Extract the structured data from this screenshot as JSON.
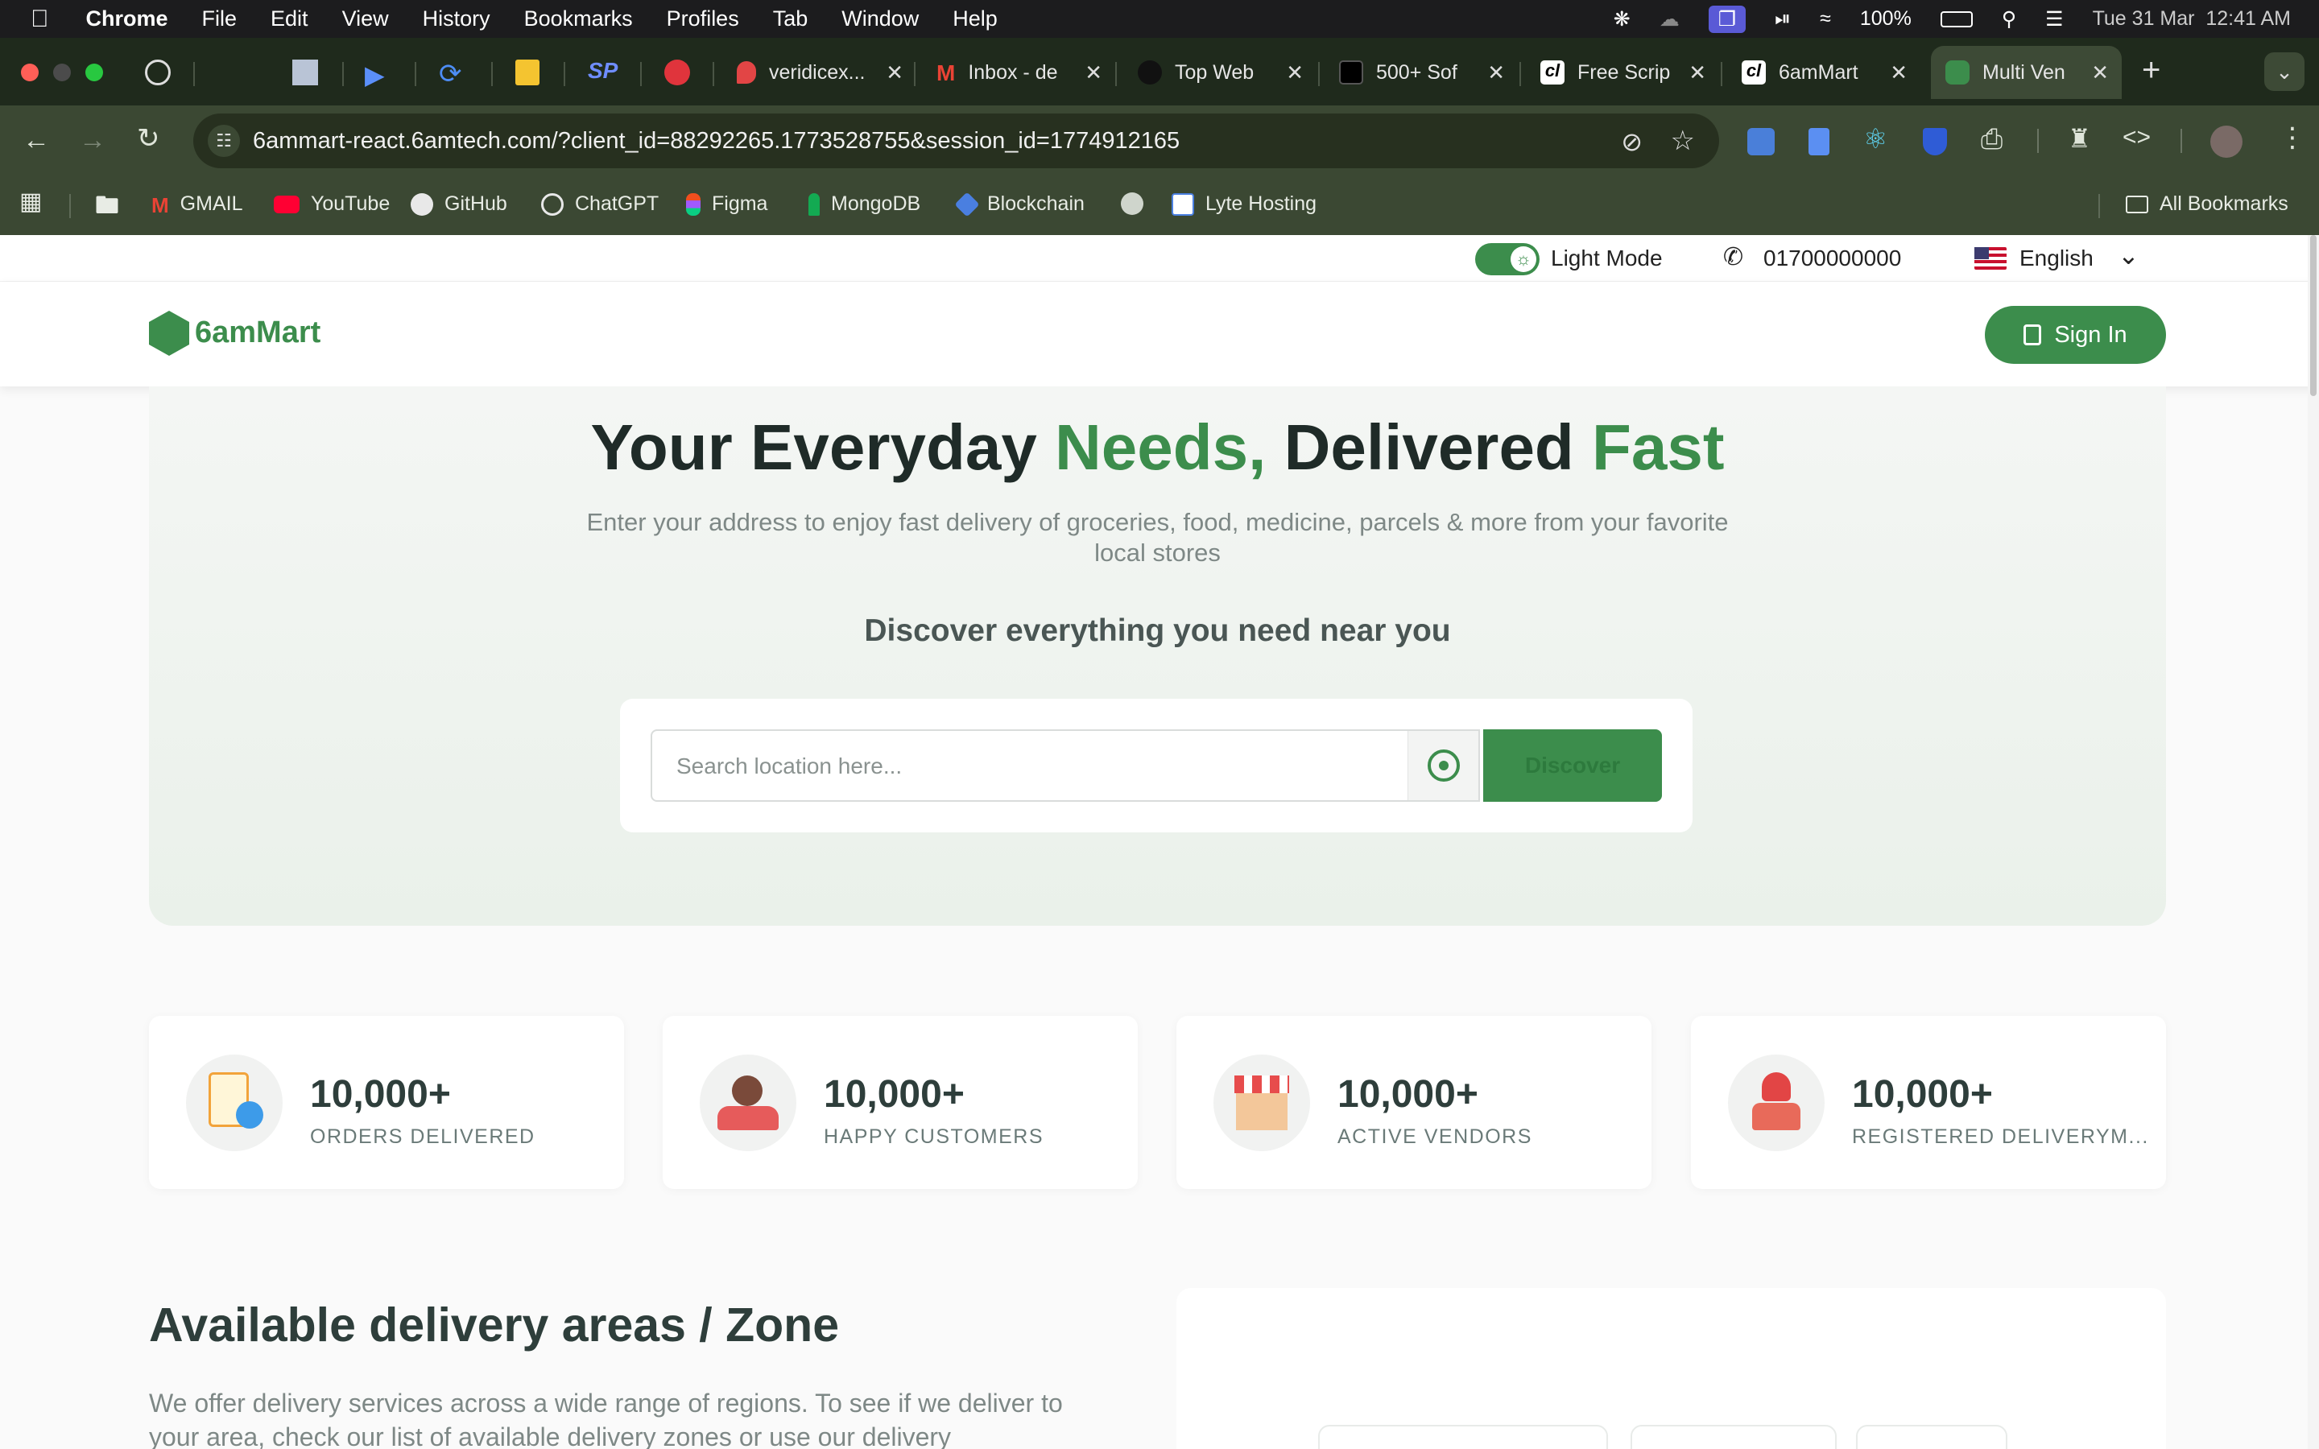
{
  "menubar": {
    "apple": "",
    "app": "Chrome",
    "items": [
      "File",
      "Edit",
      "View",
      "History",
      "Bookmarks",
      "Profiles",
      "Tab",
      "Window",
      "Help"
    ],
    "battery": "100%",
    "datetime": "Tue 31 Mar  12:41 AM"
  },
  "tabs": [
    {
      "title": "veridicex..."
    },
    {
      "title": "Inbox - de"
    },
    {
      "title": "Top Web"
    },
    {
      "title": "500+ Sof"
    },
    {
      "title": "Free Scrip"
    },
    {
      "title": "6amMart"
    },
    {
      "title": "Multi Ven"
    }
  ],
  "omnibox": {
    "url": "6ammart-react.6amtech.com/?client_id=88292265.1773528755&session_id=1774912165"
  },
  "bookmarks": [
    "GMAIL",
    "YouTube",
    "GitHub",
    "ChatGPT",
    "Figma",
    "MongoDB",
    "Blockchain",
    "Lyte Hosting"
  ],
  "all_bookmarks": "All Bookmarks",
  "site": {
    "topbar": {
      "theme_label": "Light Mode",
      "phone": "01700000000",
      "language": "English"
    },
    "logo_text": "6amMart",
    "sign_in": "Sign In",
    "hero": {
      "title_part1": "Your Everyday ",
      "title_part2": "Needs,",
      "title_part3": " Delivered ",
      "title_part4": "Fast",
      "subtitle_line1": "Enter your address to enjoy fast delivery of groceries, food, medicine, parcels & more from your favorite",
      "subtitle_line2": "local stores",
      "discover_heading": "Discover everything you need near you",
      "search_placeholder": "Search location here...",
      "discover_button": "Discover"
    },
    "stats": [
      {
        "value": "10,000+",
        "label": "ORDERS DELIVERED"
      },
      {
        "value": "10,000+",
        "label": "HAPPY CUSTOMERS"
      },
      {
        "value": "10,000+",
        "label": "ACTIVE VENDORS"
      },
      {
        "value": "10,000+",
        "label": "REGISTERED DELIVERYM..."
      }
    ],
    "zone": {
      "title": "Available delivery areas / Zone",
      "text_line1": "We offer delivery services across a wide range of regions. To see if we deliver to",
      "text_line2": "your area, check our list of available delivery zones or use our delivery"
    }
  },
  "colors": {
    "brand_green": "#3c8d4c",
    "dark_text": "#1f2b28",
    "hero_bg": "#eaf1ea"
  }
}
